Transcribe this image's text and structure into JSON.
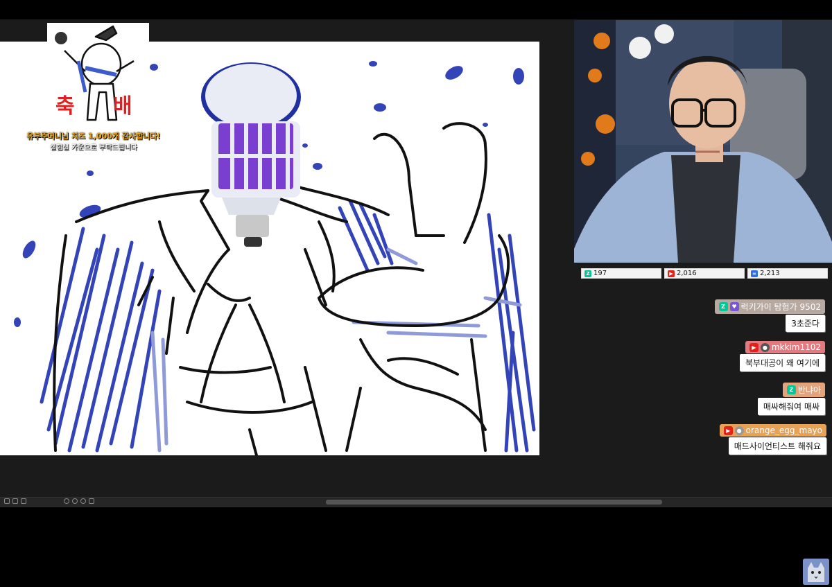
{
  "stream": {
    "stats": [
      {
        "platform": "chzzk",
        "icon": "chzzk-icon",
        "value": "197",
        "color": "#00c896"
      },
      {
        "platform": "youtube",
        "icon": "youtube-icon",
        "value": "2,016",
        "color": "#e62117"
      },
      {
        "platform": "afreeca",
        "icon": "afreeca-icon",
        "value": "2,213",
        "color": "#2f6fe0"
      }
    ]
  },
  "donation": {
    "sign_left": "축",
    "sign_right": "배",
    "line1": "유부주머니님 치즈 1,000개 감사합니다!",
    "line2": "실험실 가운으로 부탁드립니다"
  },
  "chat": [
    {
      "user": "럭키가이 탐험가 9502",
      "message": "3초준다",
      "platform": "chzzk",
      "name_bg": "#b7a8a0",
      "badge_color": "#00c896"
    },
    {
      "user": "mkkim1102",
      "message": "북부대공이 왜 여기에",
      "platform": "youtube",
      "name_bg": "#e4797f",
      "badge_color": "#e62117"
    },
    {
      "user": "반냐아",
      "message": "매싸해줘여 매싸",
      "platform": "chzzk",
      "name_bg": "#e4a37a",
      "badge_color": "#00c896"
    },
    {
      "user": "orange_egg_mayo",
      "message": "매드사이언티스트 해줘요",
      "platform": "youtube",
      "name_bg": "#e8a256",
      "badge_color": "#e62117"
    }
  ],
  "colors": {
    "canvas_bg": "#ffffff",
    "ink": "#111111",
    "blue_brush": "#3344b8",
    "light_brush": "#8f9bd9",
    "app_bg": "#1b1b1b"
  }
}
